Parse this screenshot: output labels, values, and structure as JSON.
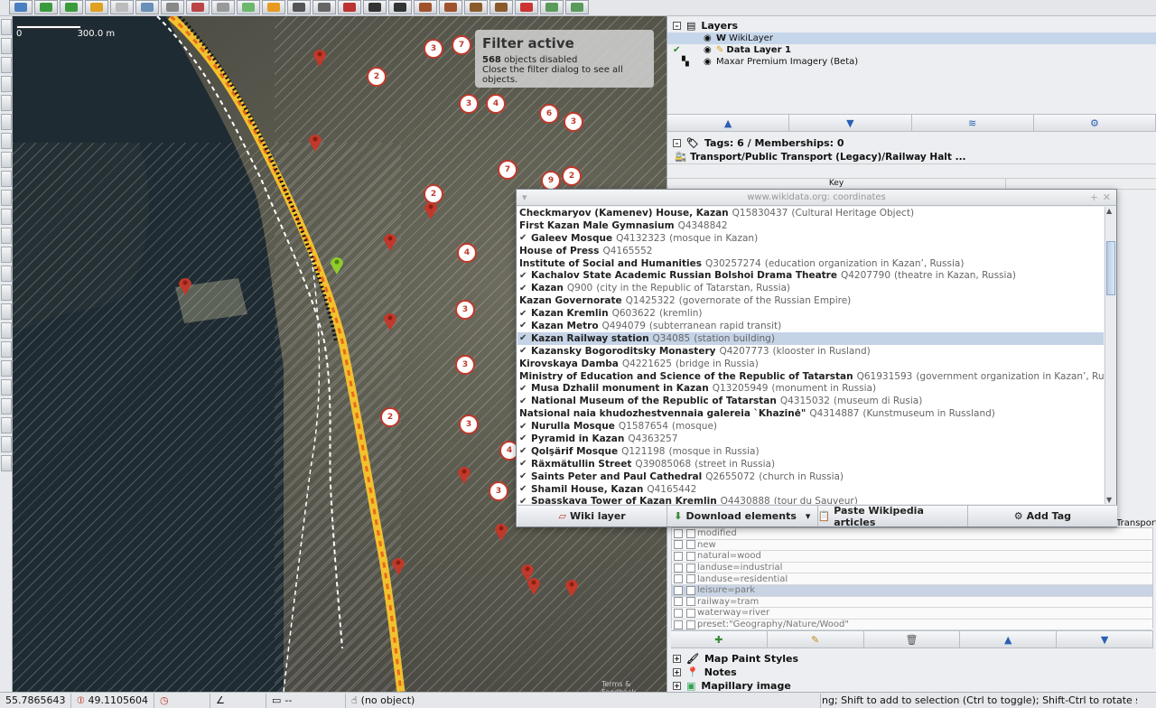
{
  "map": {
    "scale_start": "0",
    "scale_end": "300.0 m",
    "filter_title": "Filter active",
    "filter_count": "568",
    "filter_count_suffix": "objects disabled",
    "filter_hint": "Close the filter dialog to see all objects.",
    "cluster_badges": [
      "3",
      "7",
      "2",
      "3",
      "4",
      "6",
      "3",
      "7",
      "9",
      "2",
      "2",
      "4",
      "3",
      "3",
      "3",
      "2",
      "4",
      "3"
    ],
    "credit": "Terms & Feedback"
  },
  "layers": {
    "title": "Layers",
    "items": [
      {
        "name": "WikiLayer",
        "selected": true
      },
      {
        "name": "Data Layer 1",
        "active": true
      },
      {
        "name": "Maxar Premium Imagery (Beta)"
      }
    ]
  },
  "tags": {
    "title": "Tags: 6 / Memberships: 0",
    "preset": "Transport/Public Transport (Legacy)/Railway Halt ...",
    "col_key": "Key",
    "preset_overflow": "Transport/R"
  },
  "filters": [
    {
      "text": "modified",
      "highlight": false
    },
    {
      "text": "new",
      "highlight": false
    },
    {
      "text": "natural=wood",
      "highlight": false
    },
    {
      "text": "landuse=industrial",
      "highlight": false
    },
    {
      "text": "landuse=residential",
      "highlight": false
    },
    {
      "text": "leisure=park",
      "highlight": true
    },
    {
      "text": "railway=tram",
      "highlight": false
    },
    {
      "text": "waterway=river",
      "highlight": false
    },
    {
      "text": "preset:\"Geography/Nature/Wood\"",
      "highlight": false
    }
  ],
  "panels": {
    "map_paint": "Map Paint Styles",
    "notes": "Notes",
    "mapillary": "Mapillary image"
  },
  "dialog": {
    "title": "www.wikidata.org: coordinates",
    "items": [
      {
        "name": "Checkmaryov (Kamenev) House, Kazan",
        "id": "Q15830437",
        "desc": "(Cultural Heritage Object)",
        "checked": false
      },
      {
        "name": "First Kazan Male Gymnasium",
        "id": "Q4348842",
        "desc": "",
        "checked": false
      },
      {
        "name": "Galeev Mosque",
        "id": "Q4132323",
        "desc": "(mosque in Kazan)",
        "checked": true
      },
      {
        "name": "House of Press",
        "id": "Q4165552",
        "desc": "",
        "checked": false
      },
      {
        "name": "Institute of Social and Humanities",
        "id": "Q30257274",
        "desc": "(education organization in Kazan’, Russia)",
        "checked": false
      },
      {
        "name": "Kachalov State Academic Russian Bolshoi Drama Theatre",
        "id": "Q4207790",
        "desc": "(theatre in Kazan, Russia)",
        "checked": true
      },
      {
        "name": "Kazan",
        "id": "Q900",
        "desc": "(city in the Republic of Tatarstan, Russia)",
        "checked": true
      },
      {
        "name": "Kazan Governorate",
        "id": "Q1425322",
        "desc": "(governorate of the Russian Empire)",
        "checked": false
      },
      {
        "name": "Kazan Kremlin",
        "id": "Q603622",
        "desc": "(kremlin)",
        "checked": true
      },
      {
        "name": "Kazan Metro",
        "id": "Q494079",
        "desc": "(subterranean rapid transit)",
        "checked": true
      },
      {
        "name": "Kazan Railway station",
        "id": "Q34085",
        "desc": "(station building)",
        "checked": true,
        "selected": true
      },
      {
        "name": "Kazansky Bogoroditsky Monastery",
        "id": "Q4207773",
        "desc": "(klooster in Rusland)",
        "checked": true
      },
      {
        "name": "Kirovskaya Damba",
        "id": "Q4221625",
        "desc": "(bridge in Russia)",
        "checked": false
      },
      {
        "name": "Ministry of Education and Science of the Republic of Tatarstan",
        "id": "Q61931593",
        "desc": "(government organization in Kazan’, Russia)",
        "checked": false
      },
      {
        "name": "Musa Dzhalil monument in Kazan",
        "id": "Q13205949",
        "desc": "(monument in Russia)",
        "checked": true
      },
      {
        "name": "National Museum of the Republic of Tatarstan",
        "id": "Q4315032",
        "desc": "(museum di Rusia)",
        "checked": true
      },
      {
        "name": "Natsional naia khudozhestvennaia galereia `Khazinė\"",
        "id": "Q4314887",
        "desc": "(Kunstmuseum in Russland)",
        "checked": false
      },
      {
        "name": "Nurulla Mosque",
        "id": "Q1587654",
        "desc": "(mosque)",
        "checked": true
      },
      {
        "name": "Pyramid in Kazan",
        "id": "Q4363257",
        "desc": "",
        "checked": true
      },
      {
        "name": "Qolşärif Mosque",
        "id": "Q121198",
        "desc": "(mosque in Russia)",
        "checked": true
      },
      {
        "name": "Räxmätullin Street",
        "id": "Q39085068",
        "desc": "(street in Russia)",
        "checked": true
      },
      {
        "name": "Saints Peter and Paul Cathedral",
        "id": "Q2655072",
        "desc": "(church in Russia)",
        "checked": true
      },
      {
        "name": "Shamil House, Kazan",
        "id": "Q4165442",
        "desc": "",
        "checked": true
      },
      {
        "name": "Spasskaya Tower of Kazan Kremlin",
        "id": "Q4430888",
        "desc": "(tour du Sauveur)",
        "checked": true
      }
    ],
    "buttons": {
      "wiki_layer": "Wiki layer",
      "download": "Download elements",
      "paste": "Paste Wikipedia articles",
      "add_tag": "Add Tag"
    }
  },
  "status": {
    "lat": "55.7865643",
    "lon": "49.1105604",
    "dist": "--",
    "object": "(no object)",
    "help": "ng; Shift to add to selection (Ctrl to toggle); Shift-Ctrl to rotate selected; A"
  },
  "colors": {
    "marker": "#c0392b",
    "selected_row": "#c4d3e6",
    "accent": "#2b5fb4"
  }
}
